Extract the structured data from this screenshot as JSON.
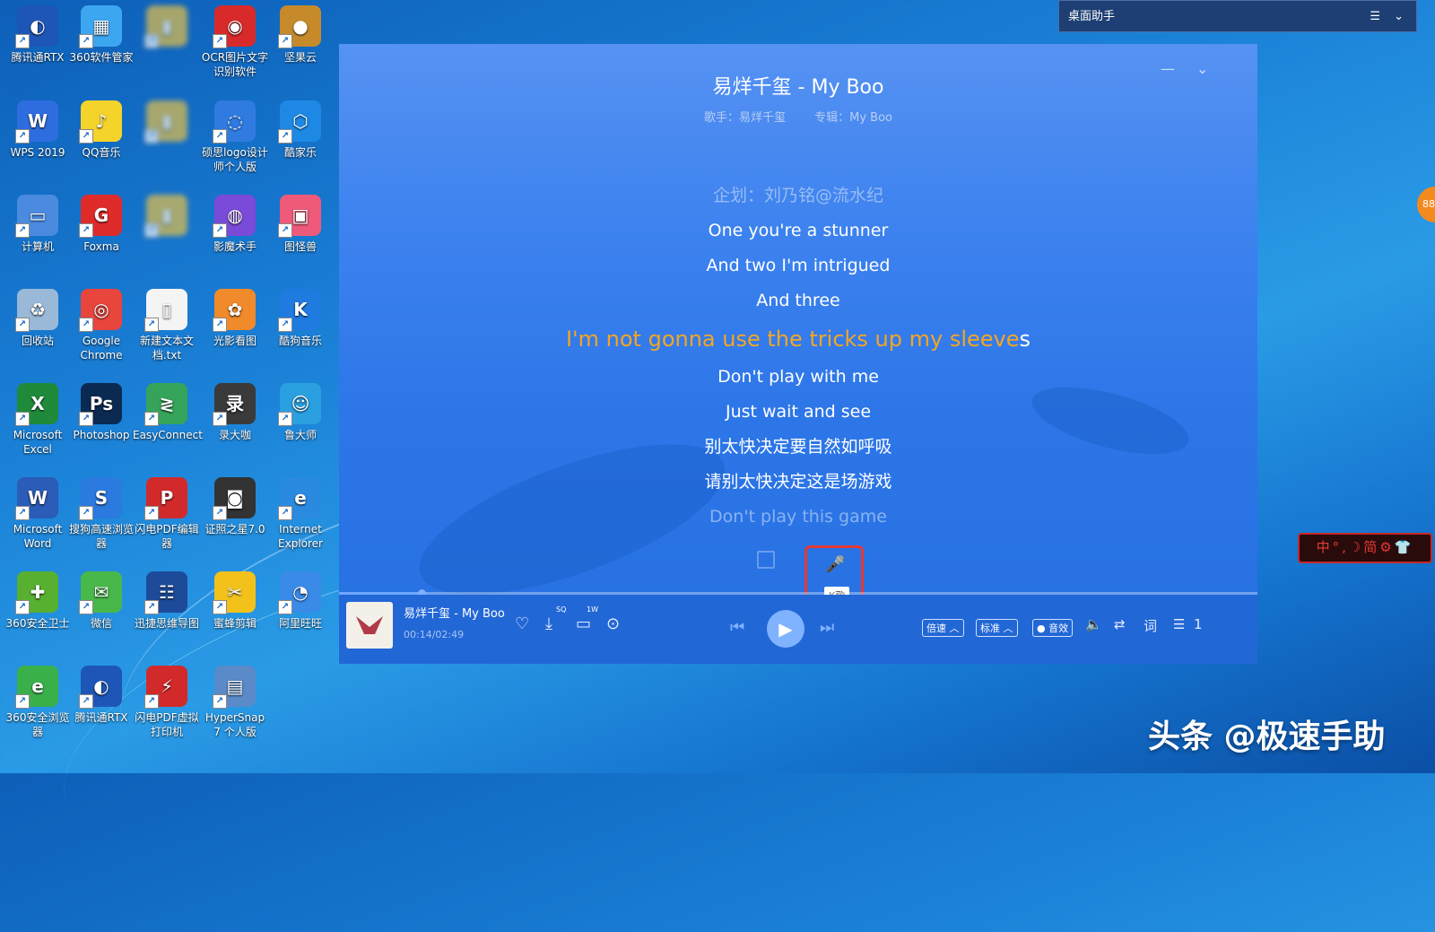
{
  "desktop": {
    "icons": [
      {
        "label": "腾讯通RTX",
        "color": "#1e56b8",
        "glyph": "◐"
      },
      {
        "label": "360软件管家",
        "color": "#3da6f0",
        "glyph": "▦"
      },
      {
        "label": "",
        "color": "#e6c14a",
        "glyph": "▮"
      },
      {
        "label": "OCR图片文字识别软件",
        "color": "#d82a2a",
        "glyph": "◉"
      },
      {
        "label": "坚果云",
        "color": "#c68a2a",
        "glyph": "●"
      },
      {
        "label": "WPS 2019",
        "color": "#2e6de0",
        "glyph": "W"
      },
      {
        "label": "QQ音乐",
        "color": "#f4d32a",
        "glyph": "♪"
      },
      {
        "label": "",
        "color": "#e6c14a",
        "glyph": "▮"
      },
      {
        "label": "硕思logo设计师个人版",
        "color": "#2f7be0",
        "glyph": "◌"
      },
      {
        "label": "酷家乐",
        "color": "#1e88e5",
        "glyph": "⬡"
      },
      {
        "label": "计算机",
        "color": "#4a8be0",
        "glyph": "▭"
      },
      {
        "label": "Foxma",
        "color": "#e02b2b",
        "glyph": "G"
      },
      {
        "label": "",
        "color": "#e6c14a",
        "glyph": "▮"
      },
      {
        "label": "影魔术手",
        "color": "#7a4ad8",
        "glyph": "◍"
      },
      {
        "label": "图怪兽",
        "color": "#f05a7a",
        "glyph": "▣"
      },
      {
        "label": "回收站",
        "color": "#9ab8d8",
        "glyph": "♻"
      },
      {
        "label": "Google Chrome",
        "color": "#e8453c",
        "glyph": "◎"
      },
      {
        "label": "新建文本文档.txt",
        "color": "#f4f4f4",
        "glyph": "▯"
      },
      {
        "label": "光影看图",
        "color": "#f08a2a",
        "glyph": "✿"
      },
      {
        "label": "酷狗音乐",
        "color": "#1f7be0",
        "glyph": "K"
      },
      {
        "label": "Microsoft Excel",
        "color": "#1f8a3a",
        "glyph": "X"
      },
      {
        "label": "Photoshop",
        "color": "#0b2a52",
        "glyph": "Ps"
      },
      {
        "label": "EasyConnect",
        "color": "#36a35a",
        "glyph": "≷"
      },
      {
        "label": "录大咖",
        "color": "#3a3a3a",
        "glyph": "录"
      },
      {
        "label": "鲁大师",
        "color": "#2aa0e0",
        "glyph": "☺"
      },
      {
        "label": "Microsoft Word",
        "color": "#2a5cb8",
        "glyph": "W"
      },
      {
        "label": "搜狗高速浏览器",
        "color": "#2a7ae0",
        "glyph": "S"
      },
      {
        "label": "闪电PDF编辑器",
        "color": "#d22a2a",
        "glyph": "P"
      },
      {
        "label": "证照之星7.0",
        "color": "#333333",
        "glyph": "◙"
      },
      {
        "label": "Internet Explorer",
        "color": "#2a8ae0",
        "glyph": "e"
      },
      {
        "label": "360安全卫士",
        "color": "#58b030",
        "glyph": "✚"
      },
      {
        "label": "微信",
        "color": "#48b84a",
        "glyph": "✉"
      },
      {
        "label": "迅捷思维导图",
        "color": "#1e4a9a",
        "glyph": "☷"
      },
      {
        "label": "蜜蜂剪辑",
        "color": "#f2c21a",
        "glyph": "✂"
      },
      {
        "label": "阿里旺旺",
        "color": "#3a8ae8",
        "glyph": "◔"
      },
      {
        "label": "360安全浏览器",
        "color": "#3ab04a",
        "glyph": "e"
      },
      {
        "label": "腾讯通RTX",
        "color": "#1e56b8",
        "glyph": "◐"
      },
      {
        "label": "闪电PDF虚拟打印机",
        "color": "#d22a2a",
        "glyph": "⚡"
      },
      {
        "label": "HyperSnap 7 个人版",
        "color": "#5a8ac8",
        "glyph": "▤"
      }
    ]
  },
  "helper": {
    "title": "桌面助手",
    "menu_icon": "☰",
    "chevron": "⌄"
  },
  "player": {
    "minimize": "—",
    "collapse": "⌄",
    "title": "易烊千玺 - My Boo",
    "artist": "歌手：易烊千玺",
    "album": "专辑：My Boo",
    "lyrics_before": [
      {
        "text": "企划：刘乃铭@流水纪",
        "dim": true
      },
      {
        "text": "One you're a stunner",
        "dim": false
      },
      {
        "text": "And two I'm intrigued",
        "dim": false
      },
      {
        "text": "And three",
        "dim": false
      }
    ],
    "current_lyric_sung": "I'm not gonna use the tricks up my sleeve",
    "current_lyric_rest": "s",
    "lyrics_after": [
      {
        "text": "Don't play with me",
        "dim": false
      },
      {
        "text": "Just wait and see",
        "dim": false
      },
      {
        "text": "别太快决定要自然如呼吸",
        "dim": false
      },
      {
        "text": "请别太快决定这是场游戏",
        "dim": false
      },
      {
        "text": "Don't play this game",
        "dim": true
      }
    ],
    "k_song_tooltip": "K歌",
    "progress": 0.09,
    "now_playing": "易烊千玺 - My Boo",
    "time": "00:14/02:49",
    "comment_badge": "1W",
    "download_badge": "SQ",
    "speed_label": "倍速 ︿",
    "quality_label": "标准 ︿",
    "effect_label": "● 音效",
    "queue_count": "1"
  },
  "side": {
    "badge": "88",
    "ime_text": "中°,☽简⚙👕"
  },
  "watermark": "头条 @极速手助"
}
